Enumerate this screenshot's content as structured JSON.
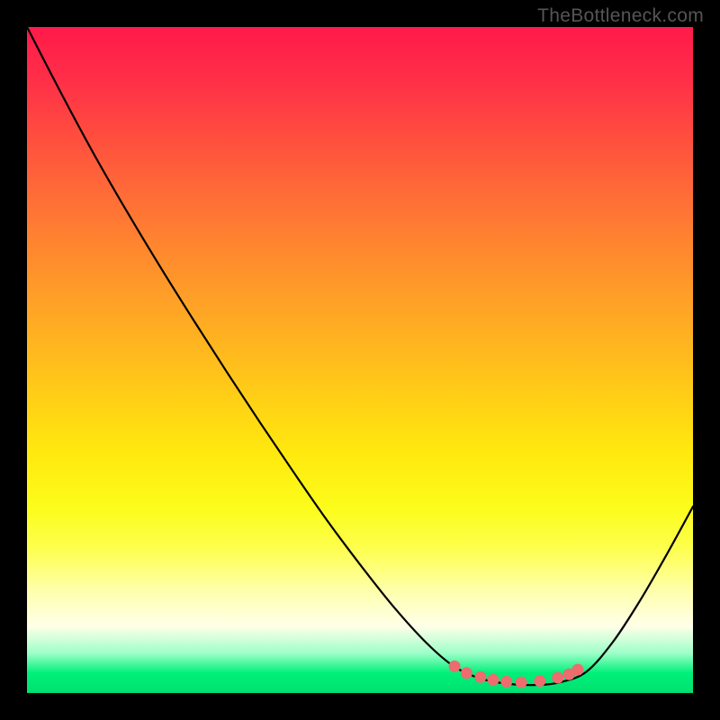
{
  "watermark": "TheBottleneck.com",
  "chart_data": {
    "type": "line",
    "title": "",
    "xlabel": "",
    "ylabel": "",
    "xlim": [
      0,
      1
    ],
    "ylim": [
      0,
      1
    ],
    "series": [
      {
        "name": "bottleneck-curve",
        "x": [
          0.0,
          0.05,
          0.1,
          0.15,
          0.2,
          0.25,
          0.3,
          0.35,
          0.4,
          0.45,
          0.5,
          0.55,
          0.6,
          0.641,
          0.68,
          0.72,
          0.76,
          0.8,
          0.84,
          0.88,
          0.92,
          0.96,
          1.0
        ],
        "values": [
          1.0,
          0.903,
          0.81,
          0.723,
          0.64,
          0.56,
          0.482,
          0.406,
          0.332,
          0.26,
          0.193,
          0.13,
          0.075,
          0.04,
          0.022,
          0.014,
          0.012,
          0.016,
          0.032,
          0.077,
          0.138,
          0.207,
          0.28
        ]
      }
    ],
    "markers": {
      "name": "highlight-dots",
      "color": "#ee6b6e",
      "x": [
        0.642,
        0.66,
        0.681,
        0.7,
        0.72,
        0.742,
        0.77,
        0.797,
        0.814,
        0.827
      ],
      "values": [
        0.04,
        0.03,
        0.024,
        0.02,
        0.017,
        0.016,
        0.018,
        0.023,
        0.028,
        0.035
      ]
    }
  }
}
